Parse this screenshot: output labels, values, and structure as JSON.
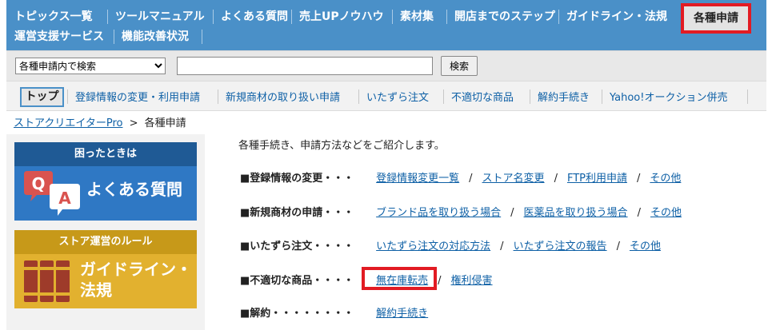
{
  "topnav": {
    "items": [
      "トピックス一覧",
      "ツールマニュアル",
      "よくある質問",
      "売上UPノウハウ",
      "素材集",
      "開店までのステップ",
      "ガイドライン・法規",
      "運営支援サービス",
      "機能改善状況"
    ],
    "active": "各種申請"
  },
  "search": {
    "scope": "各種申請内で検索",
    "value": "",
    "button": "検索"
  },
  "subnav": {
    "top": "トップ",
    "items": [
      "登録情報の変更・利用申請",
      "新規商材の取り扱い申請",
      "いたずら注文",
      "不適切な商品",
      "解約手続き",
      "Yahoo!オークション併売"
    ]
  },
  "breadcrumb": {
    "home": "ストアクリエイターPro",
    "sep": ">",
    "current": "各種申請"
  },
  "left": {
    "qa": {
      "header": "困ったときは",
      "title": "よくある質問",
      "icon_q": "Q",
      "icon_a": "A"
    },
    "guide": {
      "header": "ストア運営のルール",
      "title_line1": "ガイドライン・",
      "title_line2": "法規"
    }
  },
  "main": {
    "intro": "各種手続き、申請方法などをご紹介します。",
    "rows": [
      {
        "label": "■登録情報の変更・・・",
        "links": [
          "登録情報変更一覧",
          "ストア名変更",
          "FTP利用申請",
          "その他"
        ]
      },
      {
        "label": "■新規商材の申請・・・",
        "links": [
          "ブランド品を取り扱う場合",
          "医薬品を取り扱う場合",
          "その他"
        ]
      },
      {
        "label": "■いたずら注文・・・・",
        "links": [
          "いたずら注文の対応方法",
          "いたずら注文の報告",
          "その他"
        ]
      },
      {
        "label": "■不適切な商品・・・・",
        "links": [
          "無在庫転売",
          "権利侵害"
        ]
      },
      {
        "label": "■解約・・・・・・・・",
        "links": [
          "解約手続き"
        ]
      }
    ],
    "slash": "/"
  },
  "colors": {
    "nav_bg": "#4a90c8",
    "highlight": "#e21b23",
    "link": "#0e60a6"
  }
}
